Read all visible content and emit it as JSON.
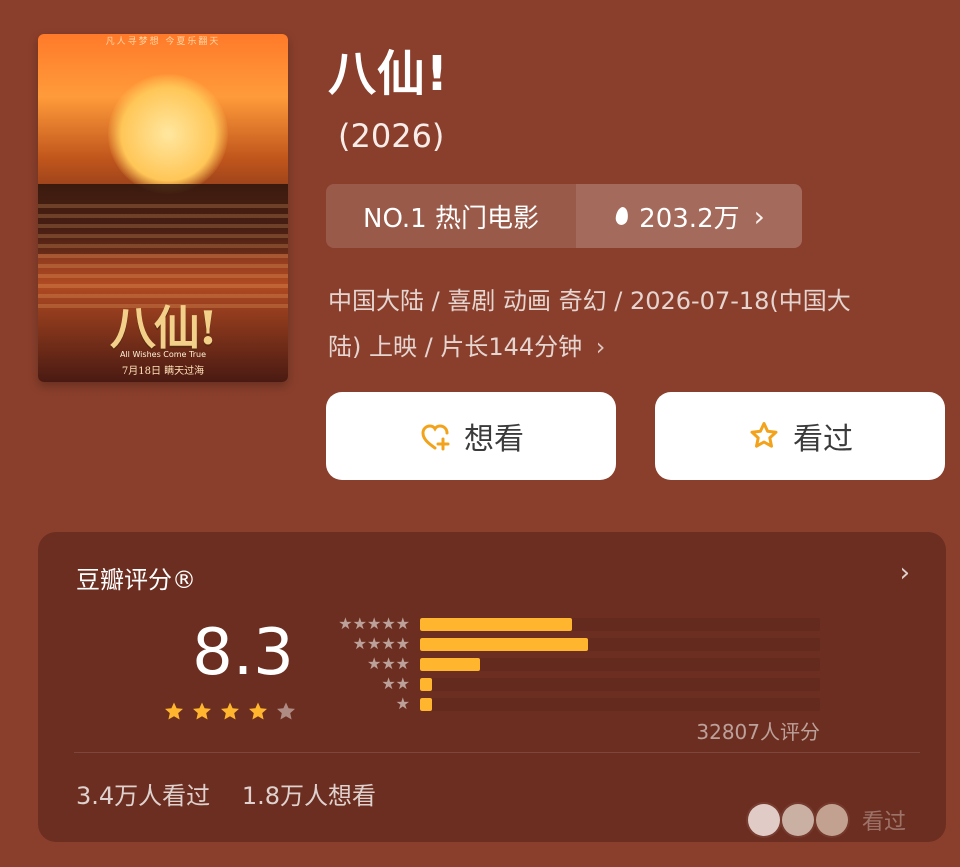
{
  "poster": {
    "tagline": "凡人寻梦想 今夏乐翻天",
    "logo_text": "八仙!",
    "subtitle": "All Wishes Come True",
    "release_line": "7月18日 瞒天过海"
  },
  "movie": {
    "title": "八仙!",
    "year": "(2026)",
    "rank_label": "NO.1 热门电影",
    "heat_value": "203.2万",
    "meta_line_1": "中国大陆 / 喜剧 动画 奇幻 / 2026-07-18(中国大",
    "meta_line_2": "陆) 上映 / 片长144分钟"
  },
  "actions": {
    "want_label": "想看",
    "seen_label": "看过"
  },
  "rating": {
    "label": "豆瓣评分®",
    "score": "8.3",
    "count_text": "32807人评分",
    "distribution": [
      {
        "stars": 5,
        "fraction": 0.38
      },
      {
        "stars": 4,
        "fraction": 0.42
      },
      {
        "stars": 3,
        "fraction": 0.15
      },
      {
        "stars": 2,
        "fraction": 0.03
      },
      {
        "stars": 1,
        "fraction": 0.03
      }
    ],
    "footer_seen": "3.4万人看过",
    "footer_want": "1.8万人想看",
    "avatars_label": "看过"
  },
  "colors": {
    "bg": "#8a3f2c",
    "card": "#6c2e20",
    "accent": "#ffb52e",
    "button": "#ffffff"
  },
  "icons": {
    "flame": "fire-icon",
    "chevron": "chevron-right-icon",
    "want": "heart-plus-icon",
    "seen": "star-outline-icon",
    "rating_star": "star-icon"
  }
}
